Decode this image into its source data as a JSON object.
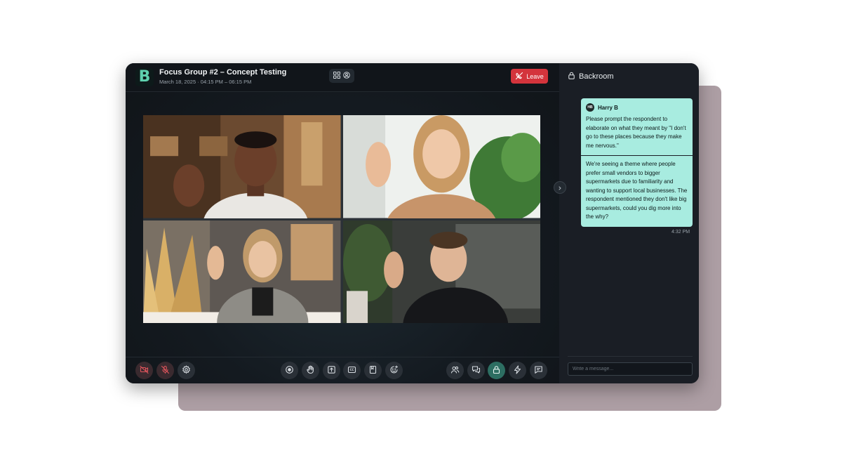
{
  "header": {
    "logo_letter": "B",
    "title": "Focus Group #2 – Concept Testing",
    "subtitle": "March 18, 2025 · 04:15 PM – 06:15 PM",
    "leave_label": "Leave"
  },
  "icons": {
    "grid_view": "grid-icon",
    "speaker_view": "user-circle-icon",
    "leave": "phone-off-icon",
    "lock": "lock-icon",
    "expand": "chevron-right-icon"
  },
  "toolbar": {
    "left": [
      "camera-off-icon",
      "mic-off-icon",
      "settings-icon"
    ],
    "center": [
      "record-icon",
      "raise-hand-icon",
      "share-screen-icon",
      "captions-icon",
      "notes-icon",
      "reactions-icon"
    ],
    "right": [
      "participants-icon",
      "chat-icon",
      "backroom-lock-icon",
      "quick-actions-icon",
      "message-icon"
    ]
  },
  "sidebar": {
    "title": "Backroom",
    "messages": [
      {
        "initials": "HB",
        "sender": "Harry B",
        "text1": "Please prompt the respondent to elaborate on what they meant by \"I don't go to these places because they make me nervous.\"",
        "text2": "We're seeing a theme where people prefer small vendors to bigger supermarkets due to familiarity and wanting to support local businesses. The respondent mentioned they don't like big supermarkets, could you dig more into the why?",
        "time": "4:32 PM"
      }
    ],
    "compose_placeholder": "Write a message..."
  },
  "colors": {
    "accent": "#2d6e62",
    "leave": "#d4343c",
    "bubble": "#a8ece0",
    "backdrop": "#ad9ea4"
  }
}
